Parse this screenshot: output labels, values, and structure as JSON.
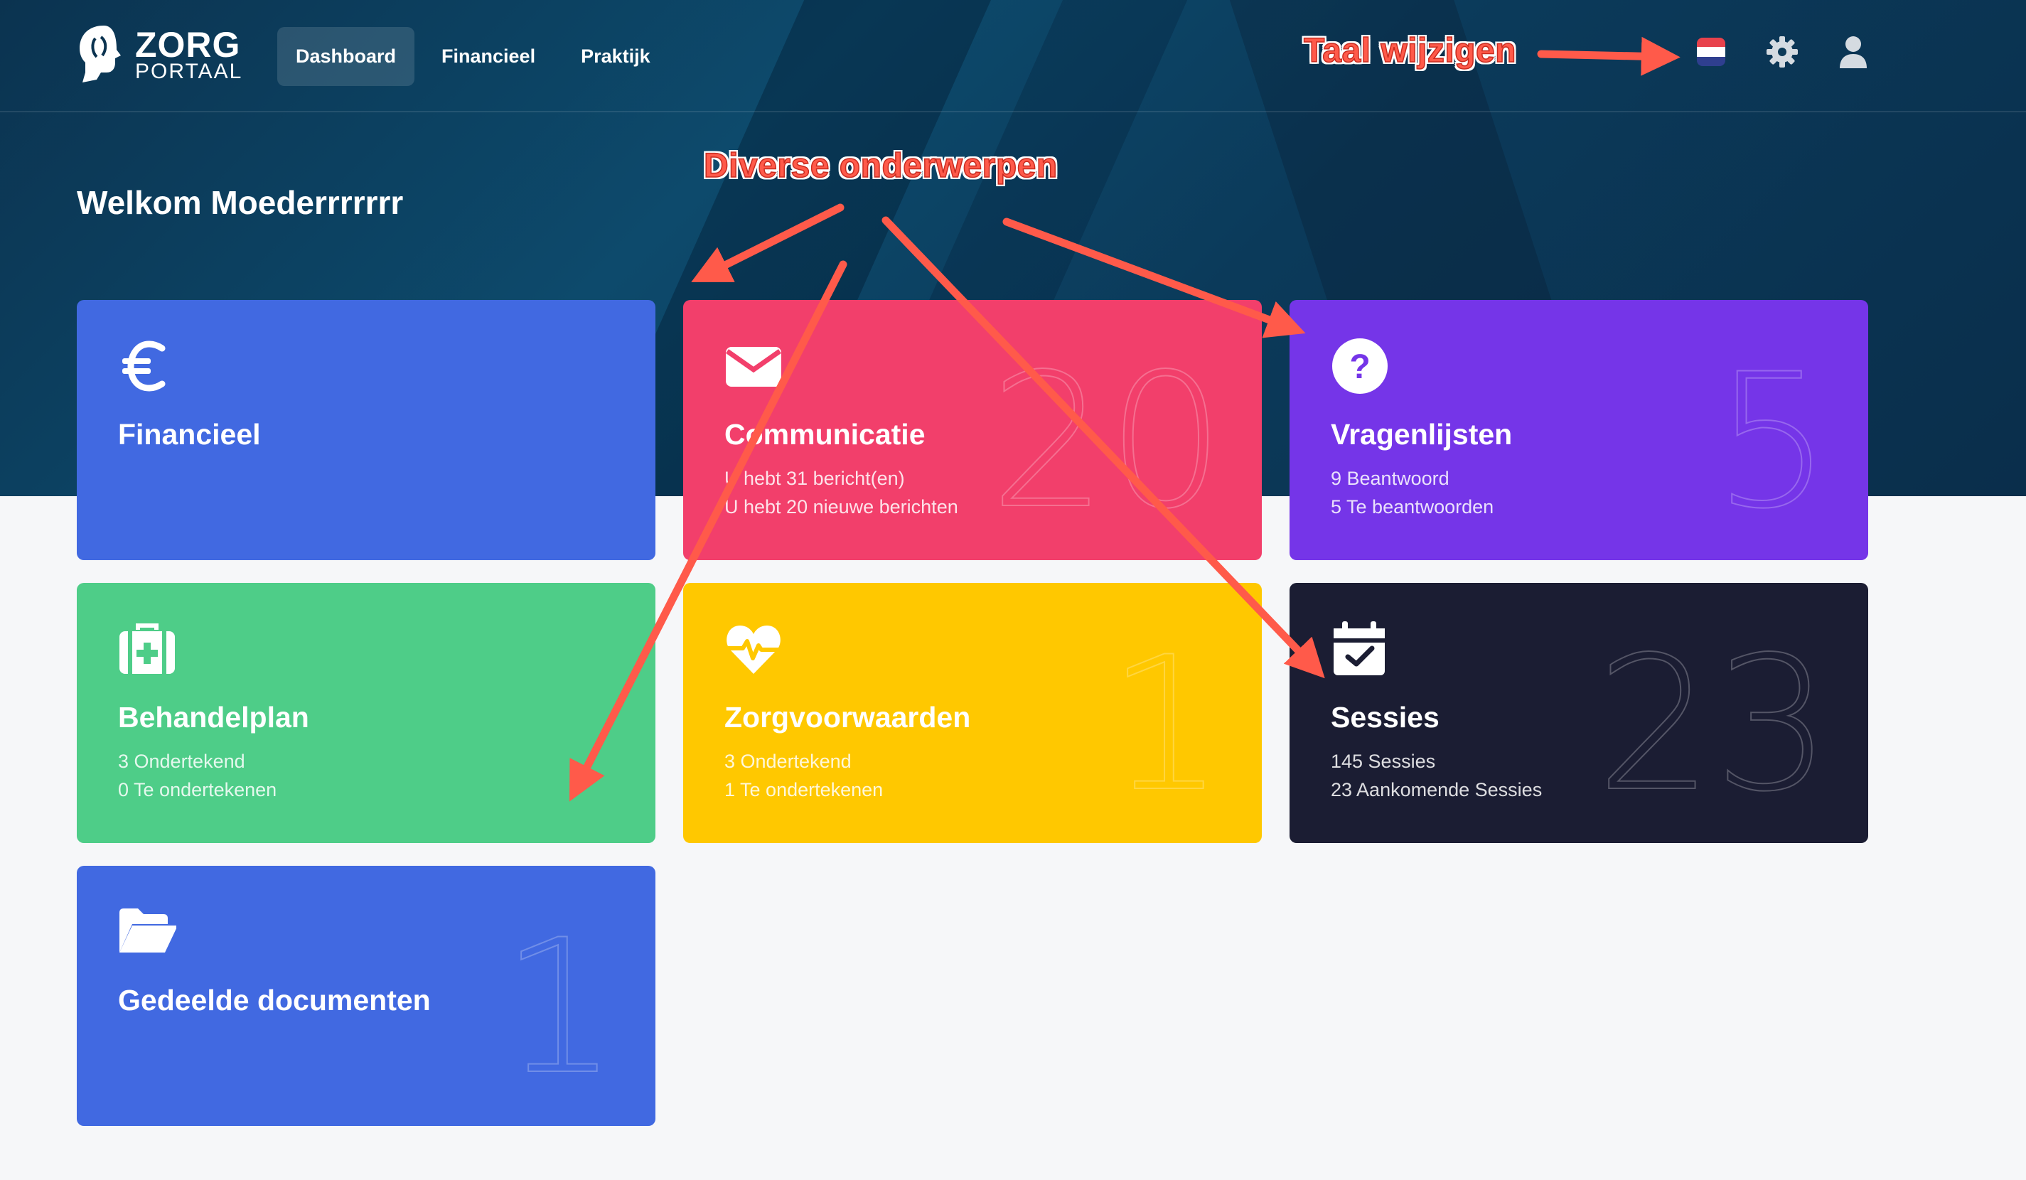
{
  "app": {
    "logo_line1": "ZORG",
    "logo_line2": "PORTAAL"
  },
  "nav": {
    "tabs": [
      {
        "label": "Dashboard",
        "active": true
      },
      {
        "label": "Financieel",
        "active": false
      },
      {
        "label": "Praktijk",
        "active": false
      }
    ],
    "icons": [
      "flag-nl-icon",
      "gear-icon",
      "user-icon"
    ]
  },
  "welcome": "Welkom Moederrrrrrr",
  "cards": [
    {
      "title": "Financieel",
      "icon": "euro-icon",
      "color": "#4169e1",
      "lines": [],
      "big_number": ""
    },
    {
      "title": "Communicatie",
      "icon": "envelope-icon",
      "color": "#f23f6b",
      "lines": [
        "U hebt 31 bericht(en)",
        "U hebt 20 nieuwe berichten"
      ],
      "big_number": "20"
    },
    {
      "title": "Vragenlijsten",
      "icon": "question-icon",
      "color": "#7535e8",
      "lines": [
        "9 Beantwoord",
        "5 Te beantwoorden"
      ],
      "big_number": "5"
    },
    {
      "title": "Behandelplan",
      "icon": "first-aid-kit-icon",
      "color": "#4ecd88",
      "lines": [
        "3 Ondertekend",
        "0 Te ondertekenen"
      ],
      "big_number": ""
    },
    {
      "title": "Zorgvoorwaarden",
      "icon": "heart-pulse-icon",
      "color": "#ffc800",
      "lines": [
        "3 Ondertekend",
        "1 Te ondertekenen"
      ],
      "big_number": "1"
    },
    {
      "title": "Sessies",
      "icon": "calendar-check-icon",
      "color": "#1b1d33",
      "lines": [
        "145 Sessies",
        "23 Aankomende Sessies"
      ],
      "big_number": "23"
    },
    {
      "title": "Gedeelde documenten",
      "icon": "folder-open-icon",
      "color": "#4169e1",
      "lines": [],
      "big_number": "1"
    }
  ],
  "annotations": {
    "language": "Taal wijzigen",
    "topics": "Diverse onderwerpen"
  },
  "colors": {
    "annotation": "#ff5a4a",
    "hero": "#0b3a5a",
    "background": "#f6f7f9"
  }
}
